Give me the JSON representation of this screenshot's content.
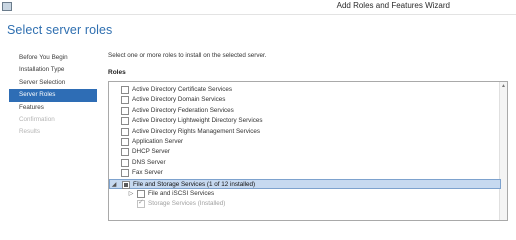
{
  "window": {
    "title": "Add Roles and Features Wizard"
  },
  "page": {
    "title": "Select server roles"
  },
  "nav": {
    "items": [
      {
        "label": "Before You Begin",
        "state": "normal"
      },
      {
        "label": "Installation Type",
        "state": "normal"
      },
      {
        "label": "Server Selection",
        "state": "normal"
      },
      {
        "label": "Server Roles",
        "state": "selected"
      },
      {
        "label": "Features",
        "state": "normal"
      },
      {
        "label": "Confirmation",
        "state": "disabled"
      },
      {
        "label": "Results",
        "state": "disabled"
      }
    ]
  },
  "main": {
    "instruction": "Select one or more roles to install on the selected server.",
    "roles_label": "Roles",
    "roles": [
      {
        "label": "Active Directory Certificate Services",
        "checked": "none",
        "level": 0,
        "expander": ""
      },
      {
        "label": "Active Directory Domain Services",
        "checked": "none",
        "level": 0,
        "expander": ""
      },
      {
        "label": "Active Directory Federation Services",
        "checked": "none",
        "level": 0,
        "expander": ""
      },
      {
        "label": "Active Directory Lightweight Directory Services",
        "checked": "none",
        "level": 0,
        "expander": ""
      },
      {
        "label": "Active Directory Rights Management Services",
        "checked": "none",
        "level": 0,
        "expander": ""
      },
      {
        "label": "Application Server",
        "checked": "none",
        "level": 0,
        "expander": ""
      },
      {
        "label": "DHCP Server",
        "checked": "none",
        "level": 0,
        "expander": ""
      },
      {
        "label": "DNS Server",
        "checked": "none",
        "level": 0,
        "expander": ""
      },
      {
        "label": "Fax Server",
        "checked": "none",
        "level": 0,
        "expander": ""
      },
      {
        "label": "File and Storage Services (1 of 12 installed)",
        "checked": "partial",
        "level": 0,
        "expander": "expanded",
        "selected": true
      },
      {
        "label": "File and iSCSI Services",
        "checked": "none",
        "level": 1,
        "expander": "collapsed"
      },
      {
        "label": "Storage Services (Installed)",
        "checked": "checked-disabled",
        "level": 1,
        "expander": ""
      }
    ]
  }
}
